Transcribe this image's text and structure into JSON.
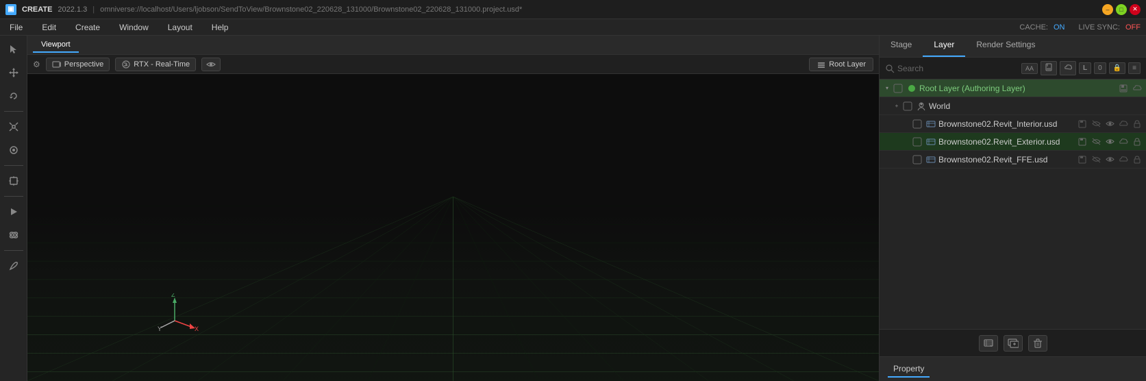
{
  "titlebar": {
    "app_name": "CREATE",
    "version": "2022.1.3",
    "separator": "|",
    "path": "omniverse://localhost/Users/ljobson/SendToView/Brownstone02_220628_131000/Brownstone02_220628_131000.project.usd*",
    "minimize_label": "–",
    "maximize_label": "□",
    "close_label": "✕"
  },
  "menubar": {
    "items": [
      "File",
      "Edit",
      "Create",
      "Window",
      "Layout",
      "Help"
    ],
    "cache_label": "CACHE:",
    "cache_status": "ON",
    "livesync_label": "LIVE SYNC:",
    "livesync_status": "OFF"
  },
  "left_toolbar": {
    "tools": [
      {
        "name": "select-tool",
        "icon": "⊹",
        "active": false
      },
      {
        "name": "move-tool",
        "icon": "✛",
        "active": false
      },
      {
        "name": "rotate-tool",
        "icon": "↻",
        "active": false
      },
      {
        "name": "scale-tool",
        "icon": "⤡",
        "active": false
      },
      {
        "name": "transform-tool",
        "icon": "⊞",
        "active": false
      },
      {
        "name": "snap-tool",
        "icon": "🧲",
        "active": false
      },
      {
        "name": "play-tool",
        "icon": "▶",
        "active": false
      },
      {
        "name": "animate-tool",
        "icon": "⏱",
        "active": false
      },
      {
        "name": "paint-tool",
        "icon": "✏",
        "active": false
      }
    ]
  },
  "viewport": {
    "tab_label": "Viewport",
    "perspective_label": "Perspective",
    "rtx_label": "RTX - Real-Time",
    "root_layer_label": "Root Layer",
    "axes": {
      "z": "Z",
      "x": "X",
      "y": "Y"
    }
  },
  "right_panel": {
    "tabs": [
      "Stage",
      "Layer",
      "Render Settings"
    ],
    "active_tab": "Layer",
    "search_placeholder": "Search",
    "layers": [
      {
        "id": "root-layer",
        "name": "Root Layer (Authoring Layer)",
        "indent": 0,
        "expanded": true,
        "active": true,
        "icon": "🟢",
        "actions": [
          "save",
          "cloud"
        ]
      },
      {
        "id": "world-layer",
        "name": "World",
        "indent": 1,
        "expanded": false,
        "active": false,
        "icon": "👤",
        "actions": []
      },
      {
        "id": "interior-layer",
        "name": "Brownstone02.Revit_Interior.usd",
        "indent": 2,
        "expanded": false,
        "active": false,
        "icon": "🗂",
        "actions": [
          "save",
          "eye",
          "visibility",
          "cloud",
          "lock"
        ]
      },
      {
        "id": "exterior-layer",
        "name": "Brownstone02.Revit_Exterior.usd",
        "indent": 2,
        "expanded": false,
        "active": false,
        "icon": "🗂",
        "actions": [
          "save",
          "eye",
          "visibility",
          "cloud",
          "lock"
        ]
      },
      {
        "id": "ffe-layer",
        "name": "Brownstone02.Revit_FFE.usd",
        "indent": 2,
        "expanded": false,
        "active": false,
        "icon": "🗂",
        "actions": [
          "save",
          "eye",
          "visibility",
          "cloud",
          "lock"
        ]
      }
    ],
    "bottom_buttons": [
      {
        "name": "add-layer-btn",
        "icon": "📄"
      },
      {
        "name": "add-sublayer-btn",
        "icon": "📋"
      },
      {
        "name": "delete-layer-btn",
        "icon": "🗑"
      }
    ],
    "property_tab": "Property"
  }
}
